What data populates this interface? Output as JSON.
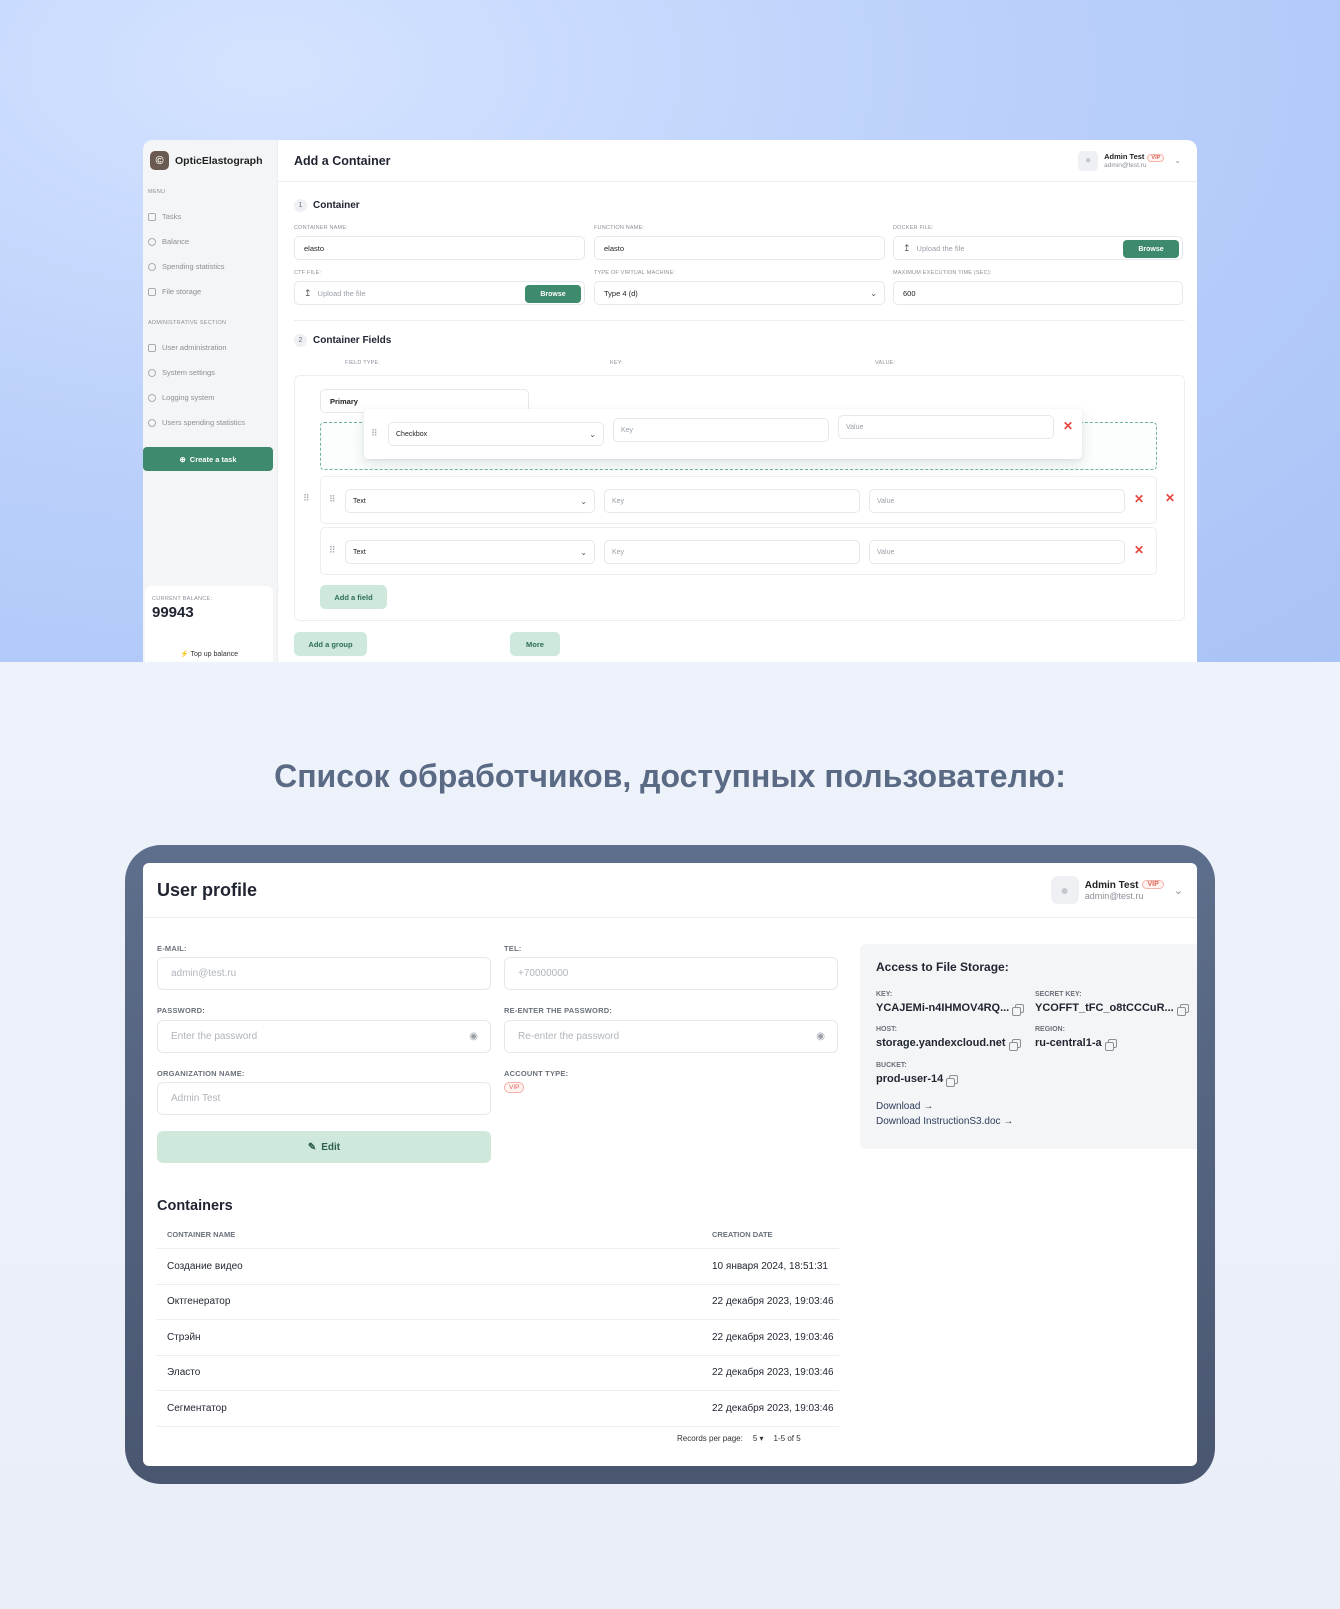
{
  "top_app": {
    "logo_text": "OpticElastograph",
    "logo_mark": "©",
    "menu_heading": "MENU",
    "menu_items": [
      "Tasks",
      "Balance",
      "Spending statistics",
      "File storage"
    ],
    "admin_heading": "ADMINISTRATIVE SECTION",
    "admin_items": [
      "User administration",
      "System settings",
      "Logging system",
      "Users spending statistics"
    ],
    "create_task": "Create a task",
    "balance_label": "CURRENT BALANCE:",
    "balance_value": "99943",
    "topup": "Top up balance",
    "page_title": "Add a Container",
    "user_name": "Admin Test",
    "user_email": "admin@test.ru",
    "vip": "VIP",
    "section1_num": "1",
    "section1_title": "Container",
    "container_name_label": "CONTAINER NAME:",
    "container_name_value": "elasto",
    "function_name_label": "FUNCTION NAME:",
    "function_name_value": "elasto",
    "docker_file_label": "DOCKER FILE:",
    "upload_placeholder": "Upload the file",
    "browse": "Browse",
    "ctf_file_label": "CTF FILE:",
    "vm_type_label": "TYPE OF VIRTUAL MACHINE:",
    "vm_type_value": "Type 4 (d)",
    "max_time_label": "MAXIMUM EXECUTION TIME (SEC):",
    "max_time_value": "600",
    "section2_num": "2",
    "section2_title": "Container Fields",
    "col_field_type": "FIELD TYPE:",
    "col_key": "KEY:",
    "col_value": "VALUE:",
    "group_name": "Primary",
    "dragging_type": "Checkbox",
    "row_types": [
      "Text",
      "Text"
    ],
    "key_placeholder": "Key",
    "value_placeholder": "Value",
    "add_field": "Add a field",
    "add_group": "Add a group",
    "more": "More"
  },
  "heading": "Список обработчиков, доступных пользователю:",
  "profile": {
    "title": "User profile",
    "user_name": "Admin Test",
    "user_email": "admin@test.ru",
    "vip": "VIP",
    "email_label": "E-MAIL:",
    "email_placeholder": "admin@test.ru",
    "tel_label": "TEL:",
    "tel_placeholder": "+70000000",
    "password_label": "PASSWORD:",
    "password_placeholder": "Enter the password",
    "repassword_label": "RE-ENTER THE PASSWORD:",
    "repassword_placeholder": "Re-enter the password",
    "org_label": "ORGANIZATION NAME:",
    "org_placeholder": "Admin Test",
    "account_type_label": "ACCOUNT TYPE:",
    "account_type_value": "VIP",
    "edit": "Edit",
    "storage": {
      "title": "Access to File Storage:",
      "key_label": "KEY:",
      "key_value": "YCAJEMi-n4IHMOV4RQ...",
      "secret_label": "SECRET KEY:",
      "secret_value": "YCOFFT_tFC_o8tCCCuR...",
      "host_label": "HOST:",
      "host_value": "storage.yandexcloud.net",
      "region_label": "REGION:",
      "region_value": "ru-central1-a",
      "bucket_label": "BUCKET:",
      "bucket_value": "prod-user-14",
      "download": "Download →",
      "download_instr": "Download InstructionS3.doc →"
    },
    "containers_title": "Containers",
    "col_name": "CONTAINER NAME",
    "col_date": "CREATION DATE",
    "rows": [
      {
        "name": "Создание видео",
        "date": "10 января 2024, 18:51:31"
      },
      {
        "name": "Октгенератор",
        "date": "22 декабря 2023, 19:03:46"
      },
      {
        "name": "Стрэйн",
        "date": "22 декабря 2023, 19:03:46"
      },
      {
        "name": "Эласто",
        "date": "22 декабря 2023, 19:03:46"
      },
      {
        "name": "Сегментатор",
        "date": "22 декабря 2023, 19:03:46"
      }
    ],
    "records_label": "Records per page:",
    "records_value": "5",
    "range": "1-5 of 5"
  }
}
